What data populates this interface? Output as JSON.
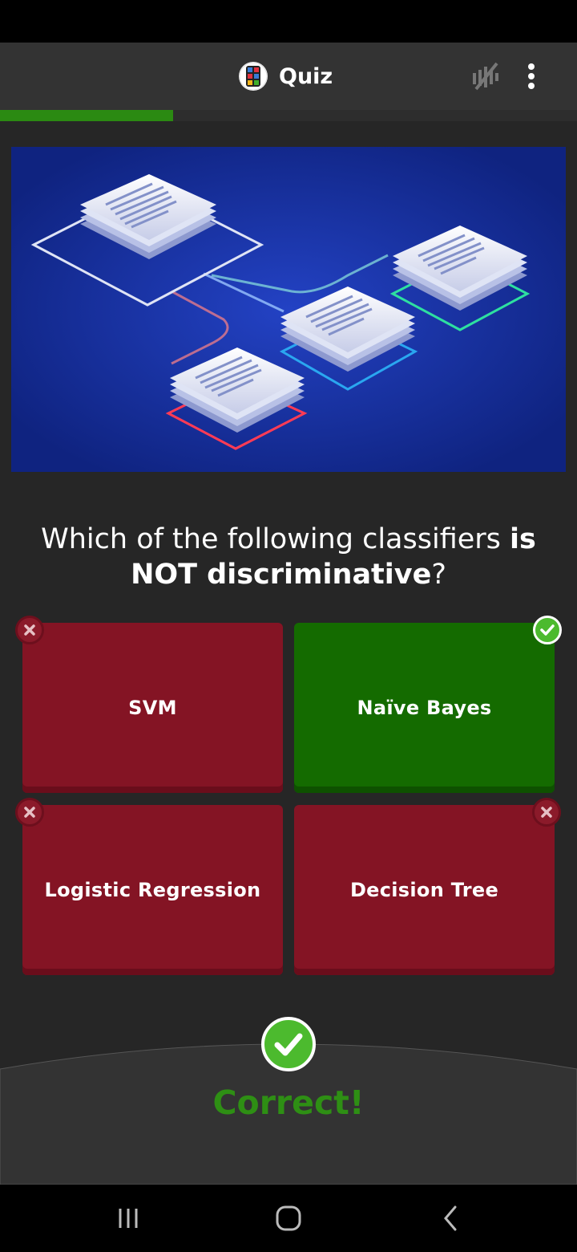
{
  "app_bar": {
    "title": "Quiz",
    "logo_icon": "quiz-app-logo",
    "mute_icon": "sound-off-icon",
    "menu_icon": "more-vertical-icon"
  },
  "progress": {
    "fraction": 0.3,
    "color": "#2b8a12"
  },
  "hero_image": {
    "description_icon": "document-layers-illustration"
  },
  "question": {
    "text_before": "Which of the following classifiers ",
    "text_bold_1": "is NOT discriminative",
    "text_after": "?"
  },
  "answers": [
    {
      "label": "SVM",
      "state": "wrong"
    },
    {
      "label": "Naïve Bayes",
      "state": "correct"
    },
    {
      "label": "Logistic Regression",
      "state": "wrong"
    },
    {
      "label": "Decision Tree",
      "state": "wrong"
    }
  ],
  "result": {
    "text": "Correct!",
    "icon": "check-circle-icon",
    "color": "#2e8f14"
  },
  "colors": {
    "wrong": "#841424",
    "correct": "#146b00",
    "background": "#262626"
  },
  "nav": {
    "recents_icon": "recents-icon",
    "home_icon": "home-icon",
    "back_icon": "back-icon"
  }
}
